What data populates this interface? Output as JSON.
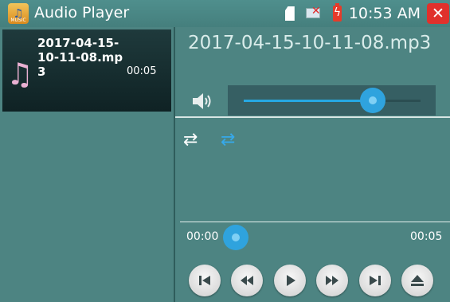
{
  "titlebar": {
    "app_icon": "music-icon",
    "app_icon_text": "MUSIC",
    "title": "Audio Player",
    "clock": "10:53 AM",
    "status_icons": [
      "sd-card-icon",
      "network-error-icon",
      "battery-charging-icon",
      "close-icon"
    ]
  },
  "playlist": {
    "items": [
      {
        "name": "2017-04-15-10-11-08.mp3",
        "duration": "00:05",
        "icon": "music-note-icon"
      }
    ]
  },
  "player": {
    "track_title": "2017-04-15-10-11-08.mp3",
    "volume_level": 0.73,
    "current_time": "00:00",
    "total_time": "00:05",
    "progress": 0.0,
    "controls": [
      "skip-previous-icon",
      "rewind-icon",
      "play-icon",
      "fast-forward-icon",
      "skip-next-icon",
      "eject-icon"
    ],
    "repeat_icons": [
      "repeat-all-icon",
      "repeat-one-icon"
    ],
    "colors": {
      "accent": "#2fa3de",
      "background": "#4d8482",
      "close": "#e0312c"
    }
  }
}
